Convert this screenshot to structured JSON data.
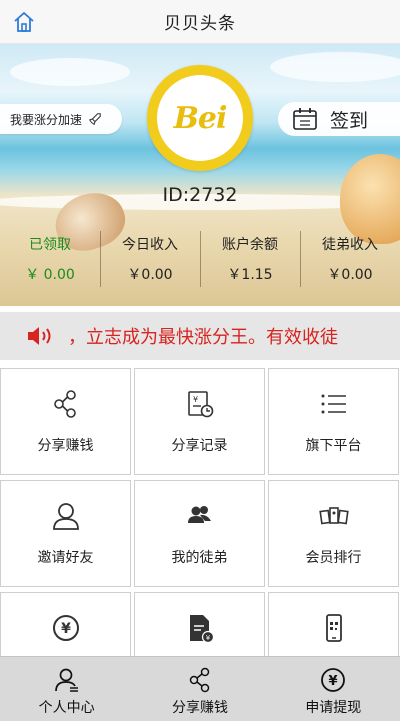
{
  "header": {
    "title": "贝贝头条",
    "home_icon": "home-icon"
  },
  "hero": {
    "speed_label": "我要涨分加速",
    "checkin_label": "签到",
    "logo_text": "Bei",
    "user_id": "ID:2732"
  },
  "stats": [
    {
      "label": "已领取",
      "value": "￥ 0.00",
      "active": true
    },
    {
      "label": "今日收入",
      "value": "￥0.00"
    },
    {
      "label": "账户余额",
      "value": "￥1.15"
    },
    {
      "label": "徒弟收入",
      "value": "￥0.00"
    }
  ],
  "notice": {
    "icon": "speaker-icon",
    "text": "，立志成为最快涨分王。有效收徒",
    "color": "#d8231f"
  },
  "grid": [
    {
      "label": "分享赚钱",
      "icon": "share-icon"
    },
    {
      "label": "分享记录",
      "icon": "share-record-icon"
    },
    {
      "label": "旗下平台",
      "icon": "list-icon"
    },
    {
      "label": "邀请好友",
      "icon": "user-icon"
    },
    {
      "label": "我的徒弟",
      "icon": "users-icon"
    },
    {
      "label": "会员排行",
      "icon": "ranking-icon"
    },
    {
      "label": "",
      "icon": "yen-circle-icon"
    },
    {
      "label": "",
      "icon": "document-yen-icon"
    },
    {
      "label": "",
      "icon": "phone-qr-icon"
    }
  ],
  "bottom_nav": [
    {
      "label": "个人中心",
      "icon": "person-icon"
    },
    {
      "label": "分享赚钱",
      "icon": "share-icon"
    },
    {
      "label": "申请提现",
      "icon": "yen-circle-icon"
    }
  ],
  "colors": {
    "accent_green": "#1b8c1b",
    "notice_red": "#d8231f",
    "logo_yellow": "#f2cc1c"
  }
}
